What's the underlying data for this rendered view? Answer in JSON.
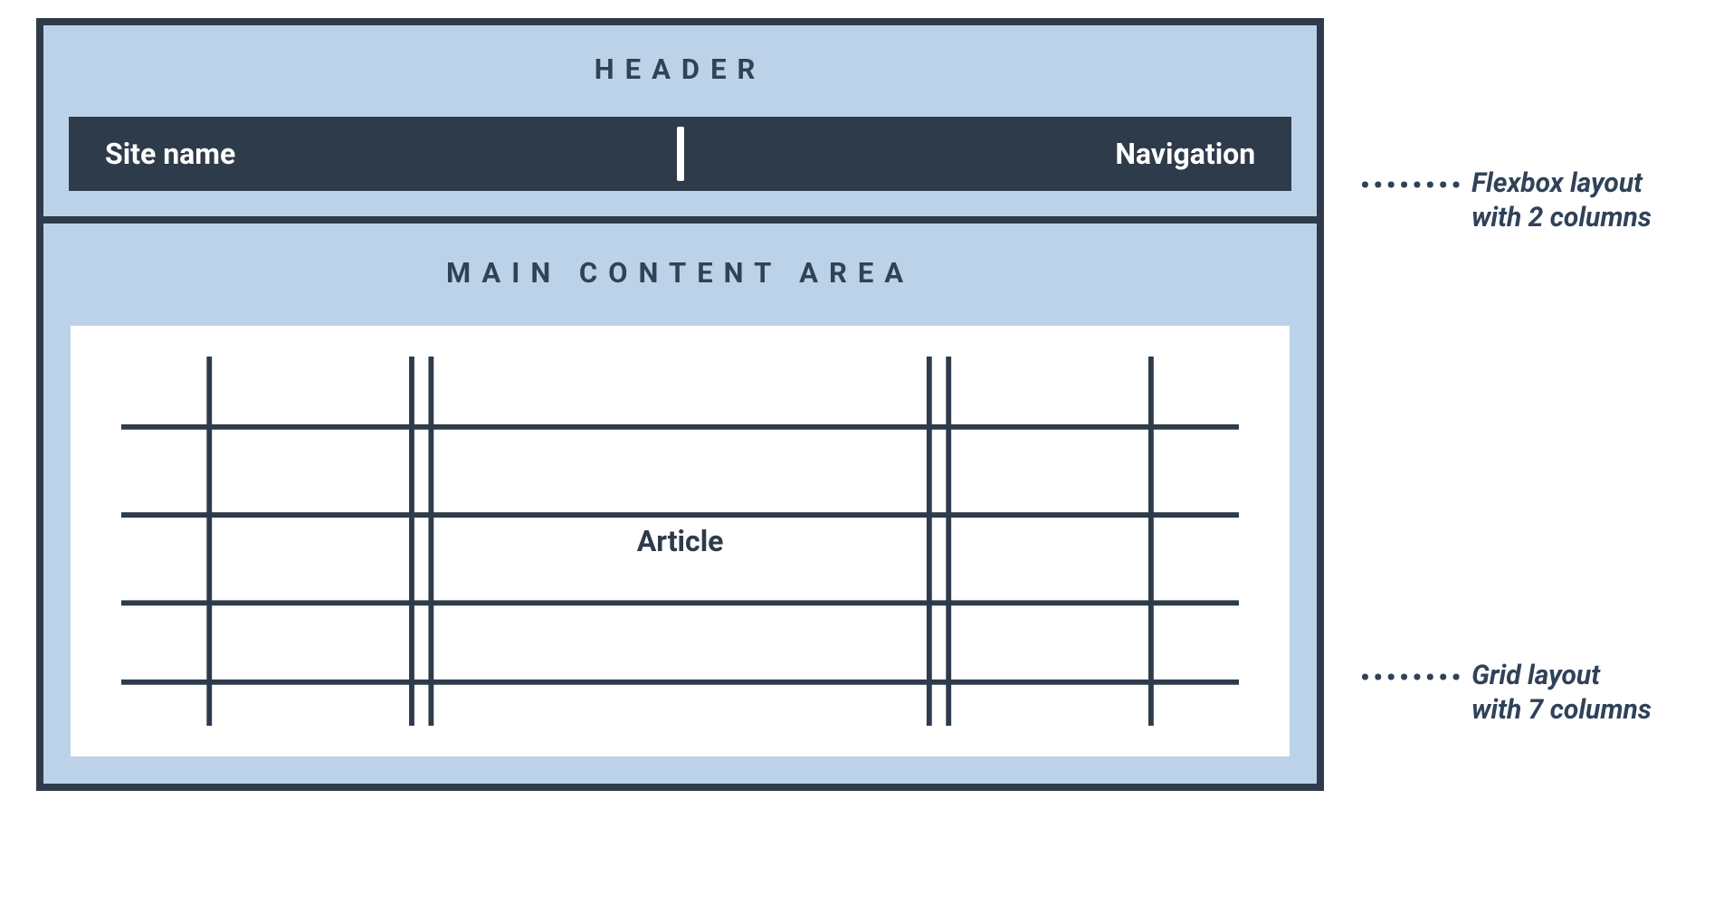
{
  "header": {
    "label": "HEADER",
    "site_name": "Site name",
    "navigation": "Navigation"
  },
  "main": {
    "label": "MAIN CONTENT AREA",
    "article": "Article",
    "grid_columns": 7,
    "grid_rows_shown": 4
  },
  "annotations": {
    "flexbox": "Flexbox layout\nwith 2 columns",
    "grid": "Grid layout\nwith 7 columns"
  },
  "colors": {
    "frame": "#2e3b4a",
    "panel": "#bcd2e9",
    "text_dark": "#304258",
    "white": "#ffffff"
  }
}
